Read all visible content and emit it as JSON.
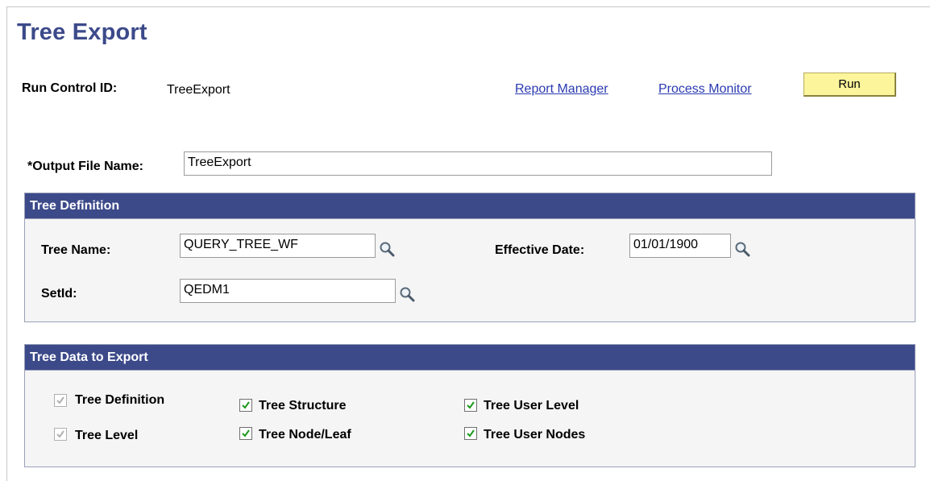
{
  "page": {
    "title": "Tree Export"
  },
  "run_control": {
    "label": "Run Control ID:",
    "value": "TreeExport"
  },
  "links": {
    "report_manager": "Report Manager",
    "process_monitor": "Process Monitor"
  },
  "run_button": {
    "label": "Run"
  },
  "output_file": {
    "label": "*Output File Name:",
    "value": "TreeExport"
  },
  "tree_definition": {
    "header": "Tree Definition",
    "tree_name": {
      "label": "Tree Name:",
      "value": "QUERY_TREE_WF"
    },
    "effective_date": {
      "label": "Effective Date:",
      "value": "01/01/1900"
    },
    "setid": {
      "label": "SetId:",
      "value": "QEDM1"
    }
  },
  "tree_data": {
    "header": "Tree Data to Export",
    "options": [
      {
        "label": "Tree Definition",
        "checked": true,
        "disabled": true
      },
      {
        "label": "Tree Level",
        "checked": true,
        "disabled": true
      },
      {
        "label": "Tree Structure",
        "checked": true,
        "disabled": false
      },
      {
        "label": "Tree Node/Leaf",
        "checked": true,
        "disabled": false
      },
      {
        "label": "Tree User Level",
        "checked": true,
        "disabled": false
      },
      {
        "label": "Tree User Nodes",
        "checked": true,
        "disabled": false
      }
    ]
  },
  "colors": {
    "title": "#3c4a8a",
    "header_bg": "#3c4a8a",
    "link": "#2a3ab0",
    "run_button_bg": "#fcf59c",
    "group_bg": "#f5f5f5",
    "check_enabled": "#1a9a1a",
    "check_disabled": "#b0b0b0"
  },
  "icons": {
    "lookup": "magnifier-icon",
    "checkbox_check": "checkmark-icon"
  }
}
